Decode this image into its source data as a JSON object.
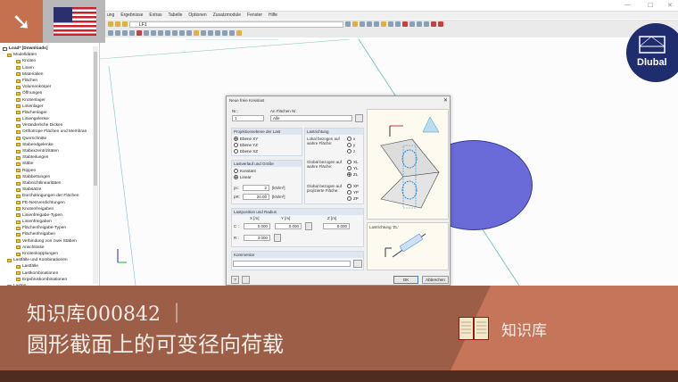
{
  "app": {
    "menu": [
      "ung",
      "Ergebnisse",
      "Extras",
      "Tabelle",
      "Optionen",
      "Zusatzmodule",
      "Fenster",
      "Hilfe"
    ],
    "loadcase": "LF1",
    "window_controls": [
      "—",
      "☐",
      "✕"
    ]
  },
  "brand": {
    "logo_text": "Dlubal"
  },
  "tree": {
    "root": "Load* [Downloads]",
    "items": [
      {
        "label": "Modelldaten",
        "level": 1
      },
      {
        "label": "Knoten",
        "level": 2
      },
      {
        "label": "Linien",
        "level": 2
      },
      {
        "label": "Materialien",
        "level": 2
      },
      {
        "label": "Flächen",
        "level": 2
      },
      {
        "label": "Volumenkörper",
        "level": 2
      },
      {
        "label": "Öffnungen",
        "level": 2
      },
      {
        "label": "Knotenlager",
        "level": 2
      },
      {
        "label": "Linienlager",
        "level": 2
      },
      {
        "label": "Flächenlager",
        "level": 2
      },
      {
        "label": "Liniengelenke",
        "level": 2
      },
      {
        "label": "Veränderliche Dicken",
        "level": 2
      },
      {
        "label": "Orthotrope Flächen und Membran",
        "level": 2
      },
      {
        "label": "Querschnitte",
        "level": 2
      },
      {
        "label": "Stabendgelenke",
        "level": 2
      },
      {
        "label": "Stabexzentrizitäten",
        "level": 2
      },
      {
        "label": "Stabteilungen",
        "level": 2
      },
      {
        "label": "Stäbe",
        "level": 2
      },
      {
        "label": "Rippen",
        "level": 2
      },
      {
        "label": "Stabbettungen",
        "level": 2
      },
      {
        "label": "Stabnichtlinearitäten",
        "level": 2
      },
      {
        "label": "Stabsätze",
        "level": 2
      },
      {
        "label": "Durchdringungen der Flächen",
        "level": 2
      },
      {
        "label": "FE-Netzverdichtungen",
        "level": 2
      },
      {
        "label": "Knotenfreigaben",
        "level": 2
      },
      {
        "label": "Linienfreigabe-Typen",
        "level": 2
      },
      {
        "label": "Linienfreigaben",
        "level": 2
      },
      {
        "label": "Flächenfreigabe-Typen",
        "level": 2
      },
      {
        "label": "Flächenfreigaben",
        "level": 2
      },
      {
        "label": "Verbindung von zwei Stäben",
        "level": 2
      },
      {
        "label": "Anschlüsse",
        "level": 2
      },
      {
        "label": "Knotenkopplungen",
        "level": 2
      },
      {
        "label": "Lastfälle und Kombinationen",
        "level": 1
      },
      {
        "label": "Lastfälle",
        "level": 2
      },
      {
        "label": "Lastkombinationen",
        "level": 2
      },
      {
        "label": "Ergebniskombinationen",
        "level": 2
      },
      {
        "label": "Lasten",
        "level": 1
      }
    ]
  },
  "dialog": {
    "title": "Neue freie Kreislast",
    "close": "✕",
    "nr_label": "Nr.:",
    "nr_value": "1",
    "surfaces_label": "An Flächen Nr.",
    "surfaces_value": "Alle",
    "projection": {
      "title": "Projektionsebene der Last",
      "options": [
        "Ebene XY",
        "Ebene YZ",
        "Ebene XZ"
      ],
      "selected": 0
    },
    "distribution": {
      "title": "Lastverlauf und Größe",
      "options": [
        "Konstant",
        "Linear"
      ],
      "selected": 1,
      "pc_label": "pc:",
      "pc_value": "2",
      "pR_label": "pR:",
      "pR_value": "20.00",
      "unit": "[kN/m²]"
    },
    "direction": {
      "title": "Lastrichtung",
      "local_label": "Lokal bezogen auf wahre Fläche:",
      "local_options": [
        "x",
        "y",
        "z"
      ],
      "global_true_label": "Global bezogen auf wahre Fläche:",
      "global_true_options": [
        "XL",
        "YL",
        "ZL"
      ],
      "global_proj_label": "Global bezogen auf projizierte Fläche:",
      "global_proj_options": [
        "XP",
        "YP",
        "ZP"
      ],
      "selected": "ZL"
    },
    "position": {
      "title": "Lastposition und Radius",
      "x_header": "X [m]",
      "y_header": "Y [m]",
      "z_header": "Z [m]",
      "c_label": "C :",
      "cx": "0.000",
      "cy": "0.000",
      "cz": "0.000",
      "r_label": "R :",
      "r_value": "3.000"
    },
    "comment_label": "Kommentar",
    "comment_value": "",
    "preview_caption": "Lastrichtung 'ZL'",
    "ok": "OK",
    "cancel": "Abbrechen"
  },
  "banner": {
    "line1": "知识库000842 ｜",
    "line2": "圆形截面上的可变径向荷载",
    "tag": "知识库"
  },
  "colors": {
    "accent": "#c5704f",
    "banner": "#9c5e47",
    "banner_light": "#c5755a",
    "footer": "#502b20",
    "dlubal": "#1f2d6e"
  }
}
